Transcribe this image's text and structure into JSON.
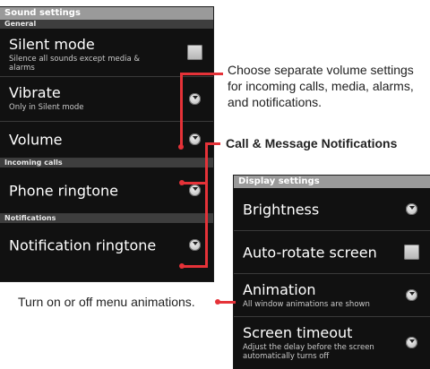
{
  "sound_panel": {
    "title": "Sound settings",
    "sections": [
      {
        "header": "General"
      },
      {
        "header": "Incoming calls"
      },
      {
        "header": "Notifications"
      }
    ],
    "items": [
      {
        "label": "Silent mode",
        "desc": "Silence all sounds except media & alarms",
        "control": "checkbox-icon"
      },
      {
        "label": "Vibrate",
        "desc": "Only in Silent mode",
        "control": "chevron-circle-icon"
      },
      {
        "label": "Volume",
        "control": "chevron-circle-icon"
      },
      {
        "label": "Phone ringtone",
        "control": "chevron-circle-icon"
      },
      {
        "label": "Notification ringtone",
        "control": "chevron-circle-icon"
      }
    ]
  },
  "display_panel": {
    "title": "Display settings",
    "items": [
      {
        "label": "Brightness",
        "control": "chevron-circle-icon"
      },
      {
        "label": "Auto-rotate screen",
        "control": "checkbox-icon"
      },
      {
        "label": "Animation",
        "desc": "All window animations are shown",
        "control": "chevron-circle-icon"
      },
      {
        "label": "Screen timeout",
        "desc": "Adjust the delay before the screen automatically turns off",
        "control": "chevron-circle-icon"
      }
    ]
  },
  "callouts": {
    "volume": "Choose separate volume settings for incoming calls, media, alarms, and notifications.",
    "notifications": "Call & Message Notifications",
    "animation": "Turn on or off menu animations."
  },
  "colors": {
    "accent_line": "#e53238",
    "panel_bg": "#111111",
    "title_bar": "#9a9a9a",
    "section_header": "#3e3e3e"
  }
}
